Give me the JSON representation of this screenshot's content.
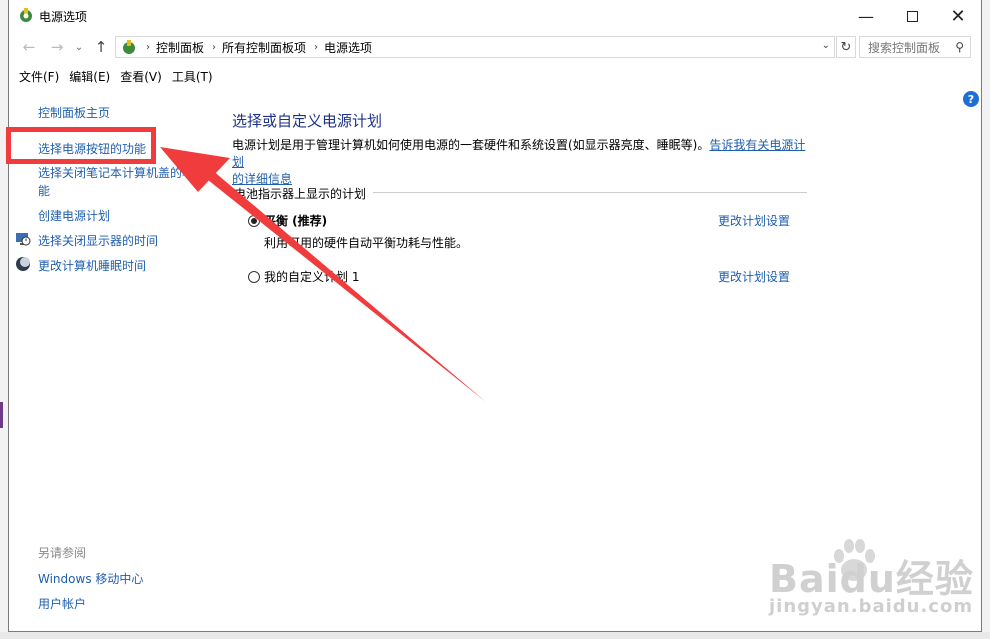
{
  "window": {
    "title": "电源选项"
  },
  "address": {
    "crumbs": [
      "控制面板",
      "所有控制面板项",
      "电源选项"
    ],
    "search_placeholder": "搜索控制面板"
  },
  "menu": {
    "items": [
      "文件(F)",
      "编辑(E)",
      "查看(V)",
      "工具(T)"
    ]
  },
  "sidebar": {
    "home": "控制面板主页",
    "items": [
      {
        "label": "选择电源按钮的功能",
        "icon": null
      },
      {
        "label_line1": "选择关闭笔记本计算机盖的功",
        "label_line2": "能",
        "icon": null
      },
      {
        "label": "创建电源计划",
        "icon": null
      },
      {
        "label": "选择关闭显示器的时间",
        "icon": "monitor-clock-icon"
      },
      {
        "label": "更改计算机睡眠时间",
        "icon": "sleep-moon-icon"
      }
    ],
    "see_also_header": "另请参阅",
    "see_also": [
      "Windows 移动中心",
      "用户帐户"
    ]
  },
  "main": {
    "title": "选择或自定义电源计划",
    "description": "电源计划是用于管理计算机如何使用电源的一套硬件和系统设置(如显示器亮度、睡眠等)。",
    "learn_more_line1": "告诉我有关电源计划",
    "learn_more_line2": "的详细信息",
    "group_label": "电池指示器上显示的计划",
    "plans": [
      {
        "name": "平衡 (推荐)",
        "description": "利用可用的硬件自动平衡功耗与性能。",
        "selected": true,
        "change_link": "更改计划设置"
      },
      {
        "name": "我的自定义计划 1",
        "description": "",
        "selected": false,
        "change_link": "更改计划设置"
      }
    ]
  },
  "watermark": {
    "brand": "Baidu经验",
    "url": "jingyan.baidu.com"
  },
  "colors": {
    "link": "#1f5fae",
    "title": "#1e3287",
    "annotation": "#f03c3c"
  }
}
